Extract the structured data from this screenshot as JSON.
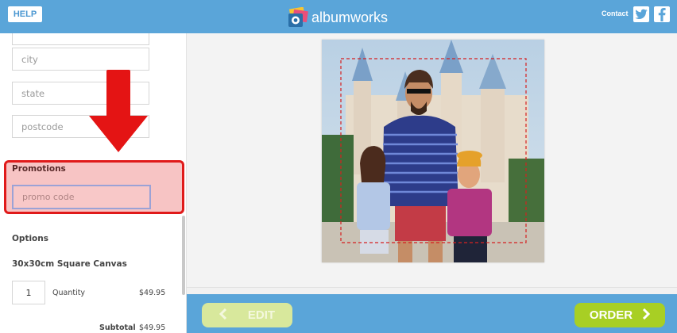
{
  "header": {
    "help_label": "HELP",
    "logo_text": "albumworks",
    "contact_label": "Contact",
    "social_icons": [
      "twitter-icon",
      "facebook-icon"
    ]
  },
  "address": {
    "city_placeholder": "city",
    "state_placeholder": "state",
    "postcode_placeholder": "postcode"
  },
  "promotions": {
    "title": "Promotions",
    "promo_placeholder": "promo code"
  },
  "options": {
    "title": "Options",
    "product": "30x30cm Square Canvas",
    "quantity_value": "1",
    "quantity_label": "Quantity",
    "unit_price": "$49.95",
    "subtotal_label": "Subtotal",
    "subtotal_value": "$49.95"
  },
  "actions": {
    "edit_label": "EDIT",
    "order_label": "ORDER"
  },
  "colors": {
    "header_blue": "#5aa5d9",
    "order_green": "#a8cf24",
    "edit_green": "#d8e89c",
    "highlight_red": "#e01a1a"
  }
}
